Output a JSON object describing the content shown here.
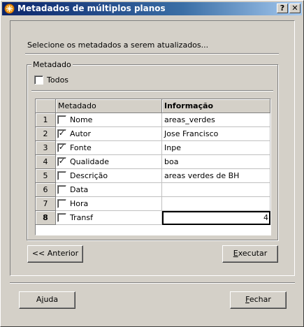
{
  "window": {
    "title": "Metadados de múltiplos planos",
    "help_glyph": "?",
    "close_glyph": "✕"
  },
  "instruction": "Selecione os metadados a serem atualizados...",
  "group": {
    "legend": "Metadado",
    "todos_label": "Todos",
    "todos_checked": false
  },
  "grid": {
    "columns": [
      "Metadado",
      "Informação"
    ],
    "rows": [
      {
        "num": "1",
        "name": "Nome",
        "checked": false,
        "info": "areas_verdes"
      },
      {
        "num": "2",
        "name": "Autor",
        "checked": true,
        "info": "Jose Francisco"
      },
      {
        "num": "3",
        "name": "Fonte",
        "checked": true,
        "info": "Inpe"
      },
      {
        "num": "4",
        "name": "Qualidade",
        "checked": true,
        "info": "boa"
      },
      {
        "num": "5",
        "name": "Descrição",
        "checked": false,
        "info": "areas verdes de BH"
      },
      {
        "num": "6",
        "name": "Data",
        "checked": false,
        "info": ""
      },
      {
        "num": "7",
        "name": "Hora",
        "checked": false,
        "info": ""
      },
      {
        "num": "8",
        "name": "Transf",
        "checked": false,
        "info": "4"
      }
    ],
    "active_row": "8"
  },
  "buttons": {
    "anterior": "<< Anterior",
    "executar": "Executar",
    "ajuda": "Ajuda",
    "fechar": "Fechar"
  },
  "colors": {
    "face": "#d4d0c8",
    "title_start": "#0a246a",
    "title_end": "#a6caf0"
  }
}
